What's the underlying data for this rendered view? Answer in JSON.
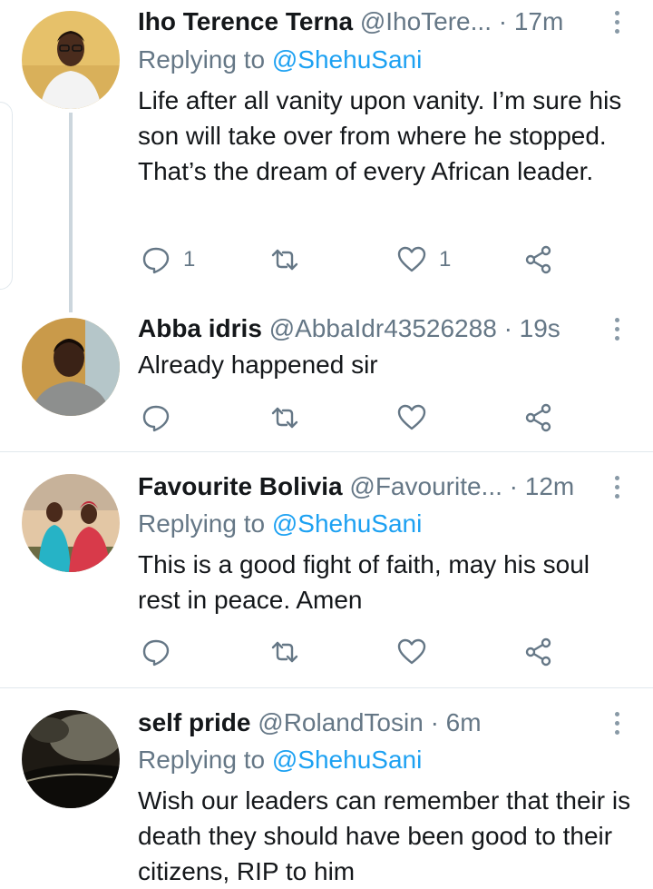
{
  "tweets": [
    {
      "name": "Iho Terence Terna",
      "handle": "@IhoTere...",
      "time": "· 17m",
      "replying_label": "Replying to",
      "replying_to": "@ShehuSani",
      "text": "Life after all vanity upon vanity. I’m sure his son will take over from where he stopped. That’s the dream of every African leader.",
      "reply_count": "1",
      "like_count": "1"
    },
    {
      "name": "Abba idris",
      "handle": "@AbbaIdr43526288",
      "time": "· 19s",
      "text": "Already happened sir"
    },
    {
      "name": "Favourite Bolivia",
      "handle": "@Favourite...",
      "time": "· 12m",
      "replying_label": "Replying to",
      "replying_to": "@ShehuSani",
      "text": "This is a good fight of faith,  may his soul rest in peace. Amen"
    },
    {
      "name": "self pride",
      "handle": "@RolandTosin",
      "time": "· 6m",
      "replying_label": "Replying to",
      "replying_to": "@ShehuSani",
      "text": "Wish our leaders can remember that their is death they should have been good to their citizens, RIP to him"
    }
  ],
  "icons": [
    "reply-icon",
    "retweet-icon",
    "like-icon",
    "share-icon",
    "more-options-icon"
  ],
  "colors": {
    "link": "#1da1f2",
    "secondary": "#657786",
    "icon": "#657786",
    "divider": "#e1e8ed",
    "thread_line": "#ccd6dd"
  }
}
